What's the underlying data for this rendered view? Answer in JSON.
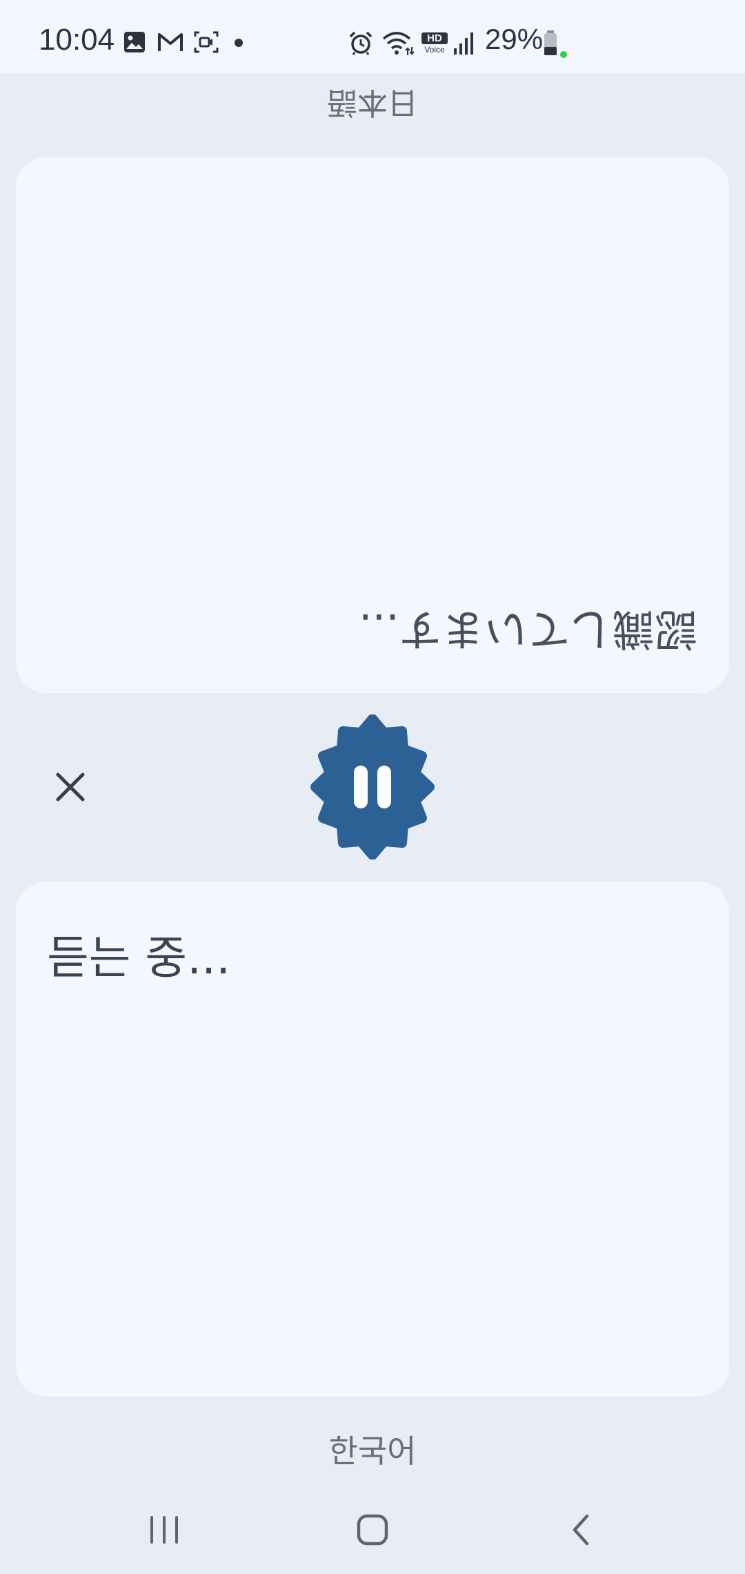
{
  "status_bar": {
    "time": "10:04",
    "battery_percent": "29%",
    "left_icons": [
      "gallery-icon",
      "gmail-icon",
      "screen-recorder-icon",
      "notification-dot-icon"
    ],
    "right_icons": [
      "alarm-icon",
      "wifi-icon",
      "hd-voice-icon",
      "signal-icon",
      "battery-icon"
    ],
    "hd_label": "HD",
    "voice_label": "Voice"
  },
  "top_panel": {
    "language": "日本語",
    "text": "認識しています..."
  },
  "controls": {
    "close_icon": "close-icon",
    "pause_icon": "pause-icon",
    "accent_color": "#2c6196"
  },
  "bottom_panel": {
    "language": "한국어",
    "text": "듣는 중..."
  },
  "nav_bar": {
    "recents_icon": "recents-icon",
    "home_icon": "home-icon",
    "back_icon": "back-icon"
  }
}
